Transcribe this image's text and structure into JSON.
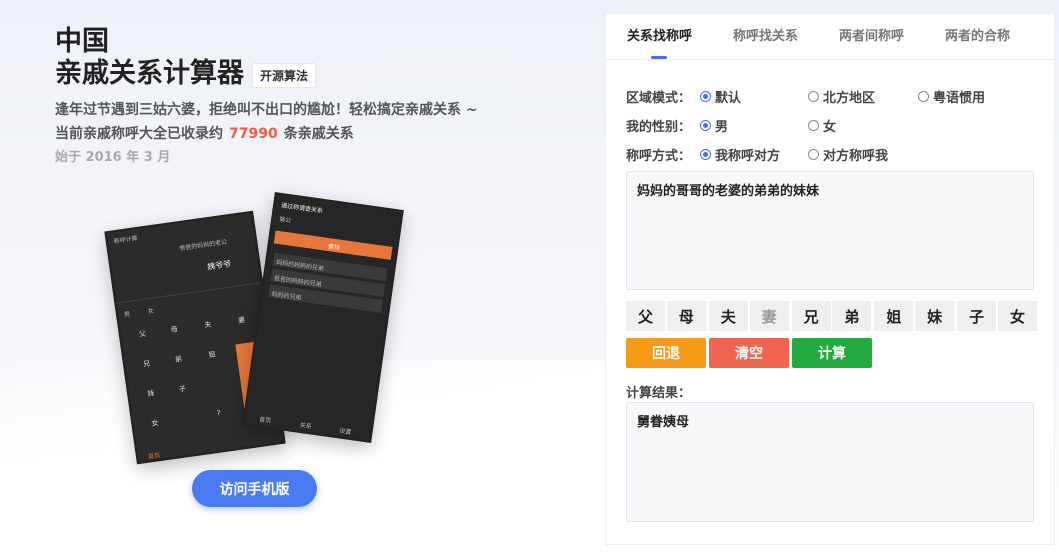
{
  "hero": {
    "title_line1": "中国",
    "title_line2": "亲戚关系计算器",
    "badge": "开源算法",
    "desc_line1": "逢年过节遇到三姑六婆，拒绝叫不出口的尴尬！轻松搞定亲戚关系 ~",
    "desc_line2_prefix": "当前亲戚称呼大全已收录约",
    "count": "77990",
    "desc_line2_suffix": "条亲戚关系",
    "since": "始于 2016 年 3 月",
    "mobile_button": "访问手机版"
  },
  "phone_left": {
    "header": "称呼计算",
    "top_text": "爸爸的妈妈的老公",
    "result": "姨爷爷",
    "gender": "男",
    "gender2": "女",
    "keys": [
      "父",
      "母",
      "夫",
      "妻",
      "兄",
      "弟",
      "姐",
      "妹",
      "子",
      "女",
      "?"
    ],
    "tab": "首页"
  },
  "phone_right": {
    "header": "通过称谓查关系",
    "input": "舅公",
    "button": "查找",
    "rows": [
      "妈妈的妈妈的兄弟",
      "爸爸的妈妈的兄弟",
      "妈妈的兄弟"
    ],
    "tabs": [
      "首页",
      "关系",
      "设置"
    ]
  },
  "tabs": [
    {
      "label": "关系找称呼"
    },
    {
      "label": "称呼找关系"
    },
    {
      "label": "两者间称呼"
    },
    {
      "label": "两者的合称"
    }
  ],
  "form": {
    "region_label": "区域模式：",
    "region_options": [
      "默认",
      "北方地区",
      "粤语惯用"
    ],
    "gender_label": "我的性别：",
    "gender_options": [
      "男",
      "女"
    ],
    "direction_label": "称呼方式：",
    "direction_options": [
      "我称呼对方",
      "对方称呼我"
    ]
  },
  "input_text": "妈妈的哥哥的老婆的弟弟的妹妹",
  "keys": [
    "父",
    "母",
    "夫",
    "妻",
    "兄",
    "弟",
    "姐",
    "妹",
    "子",
    "女"
  ],
  "actions": {
    "back": "回退",
    "clear": "清空",
    "calc": "计算"
  },
  "result_label": "计算结果：",
  "result_text": "舅眷姨母",
  "colors": {
    "accent": "#4a6cf7",
    "back": "#f79a17",
    "clear": "#f0654f",
    "calc": "#21ab3f",
    "count": "#f05a4a"
  }
}
